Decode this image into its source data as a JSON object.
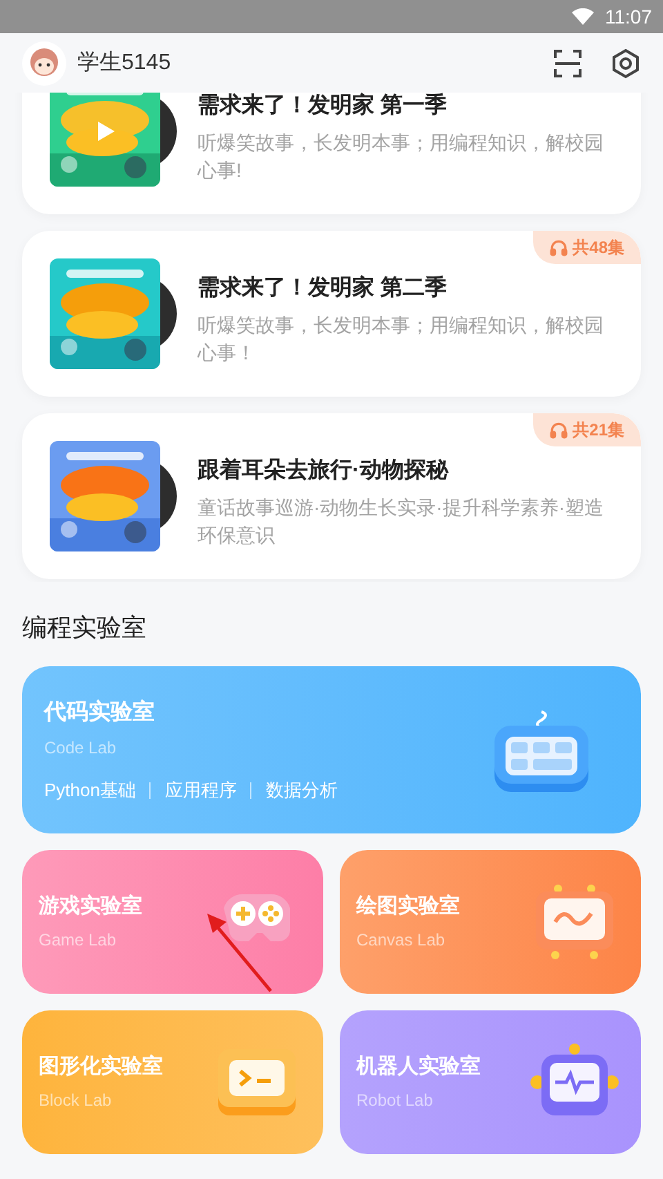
{
  "status_bar": {
    "time": "11:07"
  },
  "header": {
    "user_name": "学生5145"
  },
  "courses": [
    {
      "title": "需求来了！发明家 第一季",
      "description": "听爆笑故事，长发明本事；用编程知识，解校园心事!",
      "playing": true
    },
    {
      "title": "需求来了！发明家 第二季",
      "description": "听爆笑故事，长发明本事；用编程知识，解校园心事！",
      "episodes": "共48集",
      "playing": false
    },
    {
      "title": "跟着耳朵去旅行·动物探秘",
      "description": "童话故事巡游·动物生长实录·提升科学素养·塑造环保意识",
      "episodes": "共21集",
      "playing": false
    }
  ],
  "section_title": "编程实验室",
  "featured_lab": {
    "kind": "code",
    "title": "代码实验室",
    "subtitle": "Code Lab",
    "tags": [
      "Python基础",
      "应用程序",
      "数据分析"
    ]
  },
  "labs": [
    {
      "kind": "game",
      "title": "游戏实验室",
      "subtitle": "Game Lab",
      "annotated": true
    },
    {
      "kind": "canvas",
      "title": "绘图实验室",
      "subtitle": "Canvas Lab",
      "annotated": false
    },
    {
      "kind": "block",
      "title": "图形化实验室",
      "subtitle": "Block Lab",
      "annotated": false
    },
    {
      "kind": "robot",
      "title": "机器人实验室",
      "subtitle": "Robot Lab",
      "annotated": false
    }
  ]
}
